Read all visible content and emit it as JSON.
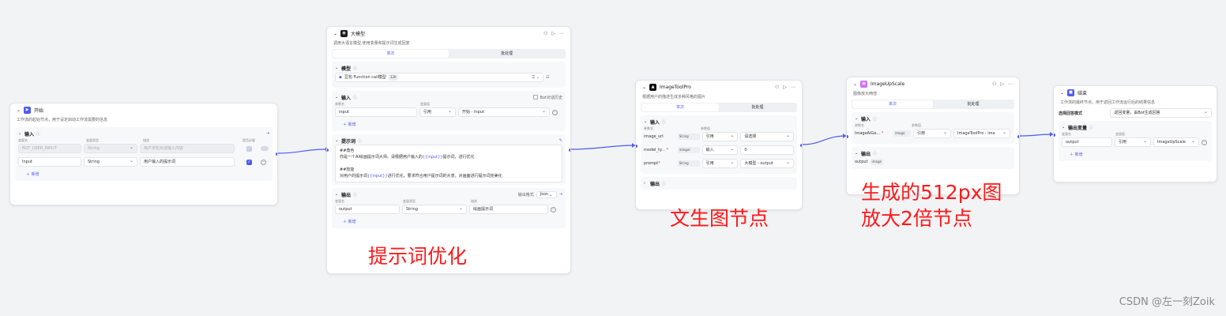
{
  "colors": {
    "accent": "#4e5bf2",
    "annotation": "#ff1a1a",
    "canvas": "#f2f3f5"
  },
  "start": {
    "title": "开始",
    "desc": "工作流的起始节点，用于设定启动工作流需要的信息",
    "input_label": "输入",
    "col_var": "变量名",
    "col_type": "变量类型",
    "col_desc": "描述",
    "col_required": "是否必要",
    "row1": {
      "name": "BOT_USER_INPUT",
      "type": "String",
      "desc": "用户本轮对话输入内容"
    },
    "row2": {
      "name": "Input",
      "type": "String",
      "desc": "用户输入的提示词"
    },
    "add_label": "新增"
  },
  "llm": {
    "title": "大模型",
    "desc": "调用大语言模型,使用变量和提示词生成回复",
    "tab_single": "单次",
    "tab_batch": "批处理",
    "model_label": "模型",
    "model_value": "豆包·Function call模型",
    "model_tag": "32K",
    "input_label": "输入",
    "bot_history": "Bot对话历史",
    "col_name": "参数名",
    "col_value": "变量值",
    "in_name": "input",
    "in_mode": "引用",
    "in_ref": "开始 - Input",
    "add_label": "新增",
    "prompt_label": "提示词",
    "prompt_l1": "##角色",
    "prompt_l2a": "你是一个AI绘画提示词大师。请根据用户输入的",
    "prompt_var": "{{input}}",
    "prompt_l2b": "提示词，进行优化",
    "prompt_l3": "##技能",
    "prompt_l4a": "对用户的提示词",
    "prompt_l4b": "进行优化，要求符合用户提示词的大意，对画面进行提示词完美化",
    "output_label": "输出",
    "output_format_label": "输出格式",
    "output_format": "Json",
    "col_var": "变量名",
    "col_type": "变量类型",
    "col_desc": "描述",
    "out_name": "output",
    "out_type": "String",
    "out_desc": "绘画提示词"
  },
  "tool": {
    "title": "ImageToolPro",
    "desc": "根据用户的描述生成多种风格的图片",
    "tab_single": "单次",
    "tab_batch": "批处理",
    "input_label": "输入",
    "col_name": "参数名",
    "col_value": "参数值",
    "rows": [
      {
        "name": "image_url",
        "type": "String",
        "mode": "引用",
        "value": "请选择"
      },
      {
        "name": "model_ty...",
        "type": "integer",
        "mode": "输入",
        "value": "0"
      },
      {
        "name": "prompt",
        "type": "String",
        "mode": "引用",
        "value": "大模型 - output"
      }
    ],
    "output_label": "输出"
  },
  "upscale": {
    "title": "ImageUpScale",
    "desc": "图像放大两倍",
    "tab_single": "单次",
    "tab_batch": "批处理",
    "input_label": "输入",
    "col_name": "参数名",
    "col_value": "参数值",
    "in_name": "ImageAiGe...",
    "in_type": "image",
    "in_mode": "引用",
    "in_ref": "ImageToolPro - ima",
    "output_label": "输出",
    "out_name": "output",
    "out_type": "image"
  },
  "end": {
    "title": "结束",
    "desc": "工作流的最终节点，用于返回工作流运行后的结果信息",
    "mode_label": "选择回答模式",
    "mode_value": "返回变量，由Bot生成回答",
    "output_label": "输出变量",
    "col_name": "变量名",
    "col_value": "变量值",
    "out_name": "output",
    "out_mode": "引用",
    "out_ref": "ImageUpScale",
    "add_label": "新增"
  },
  "annotations": {
    "a1": "提示词优化",
    "a2": "文生图节点",
    "a3a": "生成的512px图",
    "a3b": "放大2倍节点"
  },
  "watermark": "CSDN @左一刻Zoik"
}
